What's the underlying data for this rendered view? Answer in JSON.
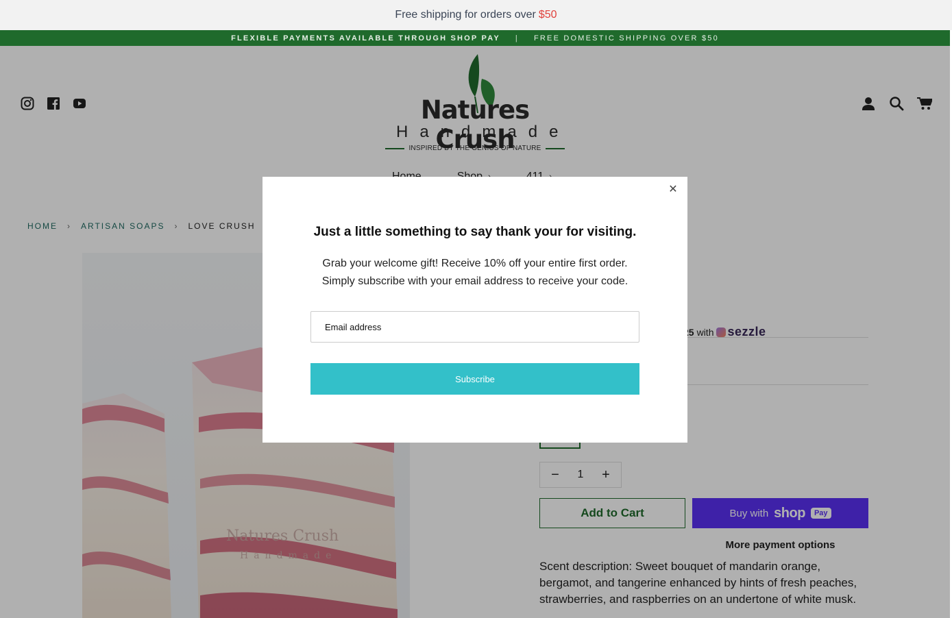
{
  "promo": {
    "text": "Free shipping for orders over",
    "amount": "$50"
  },
  "announcement": {
    "left": "FLEXIBLE PAYMENTS AVAILABLE THROUGH SHOP PAY",
    "separator": "|",
    "right": "FREE DOMESTIC SHIPPING OVER $50"
  },
  "header": {
    "social_icons": [
      "instagram-icon",
      "facebook-icon",
      "youtube-icon"
    ],
    "right_icons": [
      "account-icon",
      "search-icon",
      "cart-icon"
    ],
    "logo": {
      "brand": "Natures Crush",
      "sub": "Handmade",
      "tagline": "INSPIRED BY THE GENIUS OF NATURE"
    }
  },
  "nav": {
    "items": [
      {
        "label": "Home"
      },
      {
        "label": "Shop"
      },
      {
        "label": "411"
      }
    ]
  },
  "breadcrumb": {
    "home": "HOME",
    "category": "ARTISAN SOAPS",
    "current": "LOVE CRUSH"
  },
  "product": {
    "sezzle_amount": "25",
    "sezzle_with": "with",
    "sezzle_brand": "sezzle",
    "quantity": "1",
    "add_to_cart": "Add to Cart",
    "shoppay_prefix": "Buy with",
    "shoppay_brand": "shop",
    "shoppay_pay": "Pay",
    "more_payment": "More payment options",
    "description": "Scent description: Sweet bouquet of mandarin orange, bergamot, and tangerine enhanced by hints of fresh peaches, strawberries, and raspberries on an undertone of white musk."
  },
  "modal": {
    "title": "Just a little something to say thank your for visiting.",
    "line1": "Grab your welcome gift!  Receive 10% off your entire first order.",
    "line2": "Simply subscribe with your email address to receive your code.",
    "email_placeholder": "Email address",
    "subscribe": "Subscribe"
  },
  "colors": {
    "brand_green": "#1f6a2c",
    "subscribe_teal": "#33c0c9",
    "shoppay_purple": "#5a31f4",
    "promo_red": "#e0413b"
  }
}
